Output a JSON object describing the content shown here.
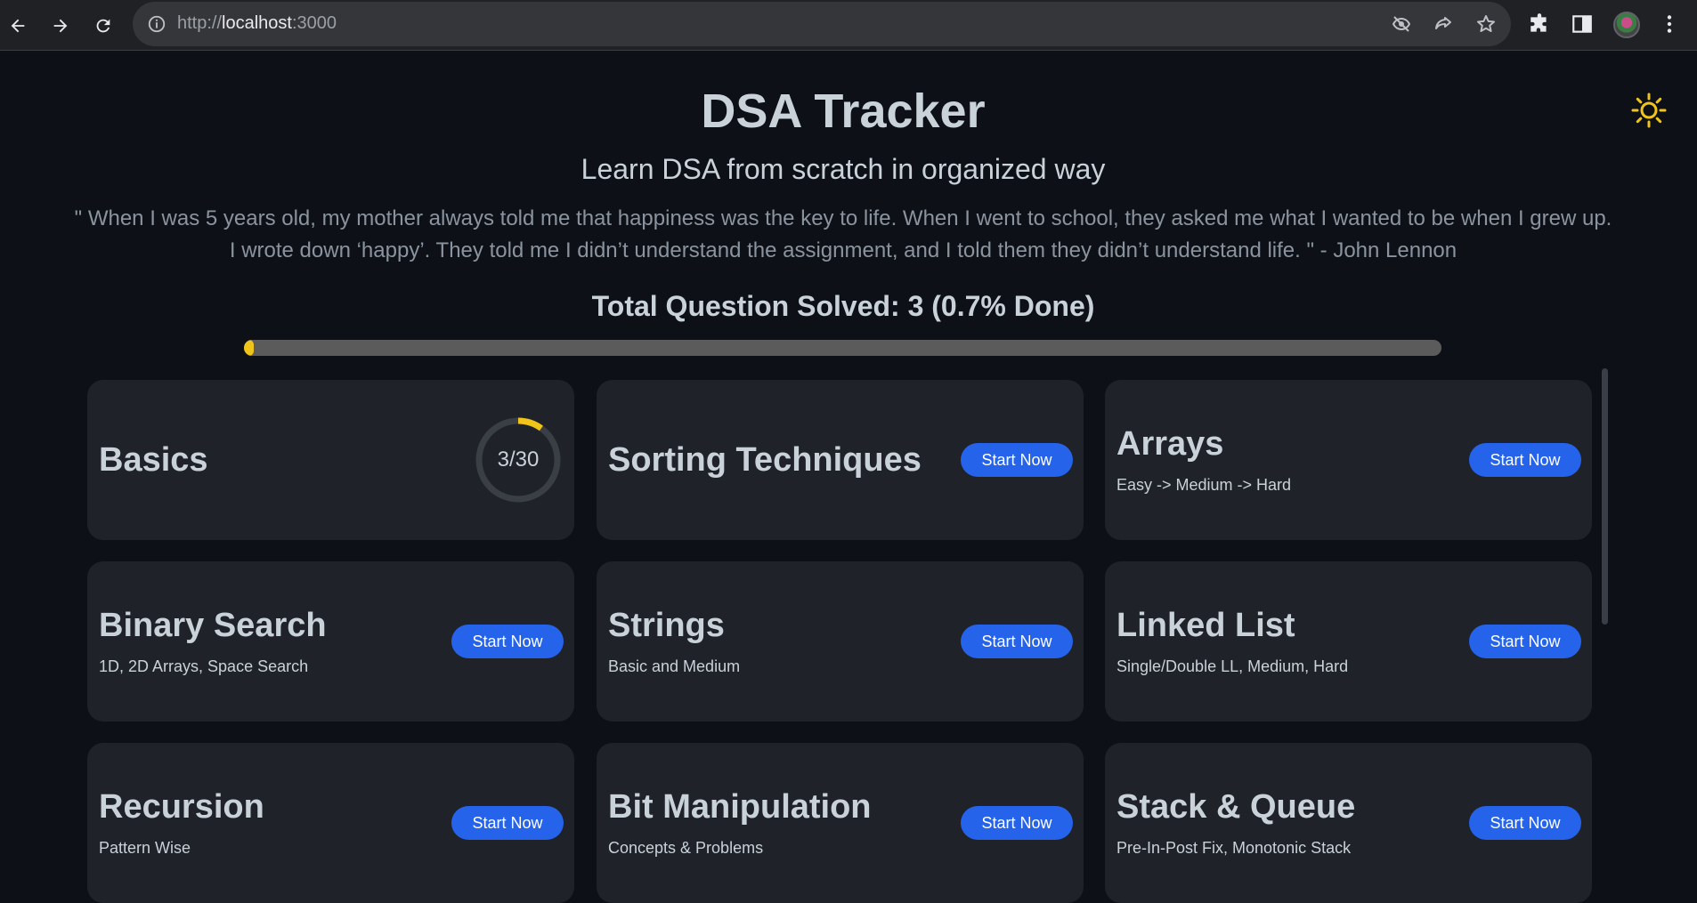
{
  "browser": {
    "url_scheme": "http://",
    "url_host": "localhost",
    "url_port": ":3000"
  },
  "header": {
    "title": "DSA Tracker",
    "subtitle": "Learn DSA from scratch in organized way",
    "quote_line1": "\" When I was 5 years old, my mother always told me that happiness was the key to life. When I went to school, they asked me what I wanted to be when I grew up.",
    "quote_line2": "I wrote down ‘happy’. They told me I didn’t understand the assignment, and I told them they didn’t understand life. \" - John Lennon"
  },
  "progress": {
    "label": "Total Question Solved: 3 (0.7% Done)",
    "fraction": 0.007,
    "color": "#f0c419"
  },
  "colors": {
    "background": "#0d1117",
    "card": "#1f2329",
    "accent_button": "#2563eb",
    "progress_yellow": "#f0c419"
  },
  "topics": [
    {
      "title": "Basics",
      "subtitle": "",
      "progress_text": "3/30",
      "solved": 3,
      "total": 30
    },
    {
      "title": "Sorting Techniques",
      "subtitle": "",
      "button": "Start Now"
    },
    {
      "title": "Arrays",
      "subtitle": "Easy -> Medium -> Hard",
      "button": "Start Now"
    },
    {
      "title": "Binary Search",
      "subtitle": "1D, 2D Arrays, Space Search",
      "button": "Start Now"
    },
    {
      "title": "Strings",
      "subtitle": "Basic and Medium",
      "button": "Start Now"
    },
    {
      "title": "Linked List",
      "subtitle": "Single/Double LL, Medium, Hard",
      "button": "Start Now"
    },
    {
      "title": "Recursion",
      "subtitle": "Pattern Wise",
      "button": "Start Now"
    },
    {
      "title": "Bit Manipulation",
      "subtitle": "Concepts & Problems",
      "button": "Start Now"
    },
    {
      "title": "Stack & Queue",
      "subtitle": "Pre-In-Post Fix, Monotonic Stack",
      "button": "Start Now"
    }
  ],
  "icons": {
    "back": "arrow-left-icon",
    "forward": "arrow-right-icon",
    "reload": "reload-icon",
    "site_info": "info-icon",
    "tracking": "eye-off-icon",
    "share": "share-icon",
    "bookmark": "star-icon",
    "extensions": "puzzle-icon",
    "side_panel": "side-panel-icon",
    "menu": "kebab-menu-icon",
    "theme": "sun-icon"
  }
}
